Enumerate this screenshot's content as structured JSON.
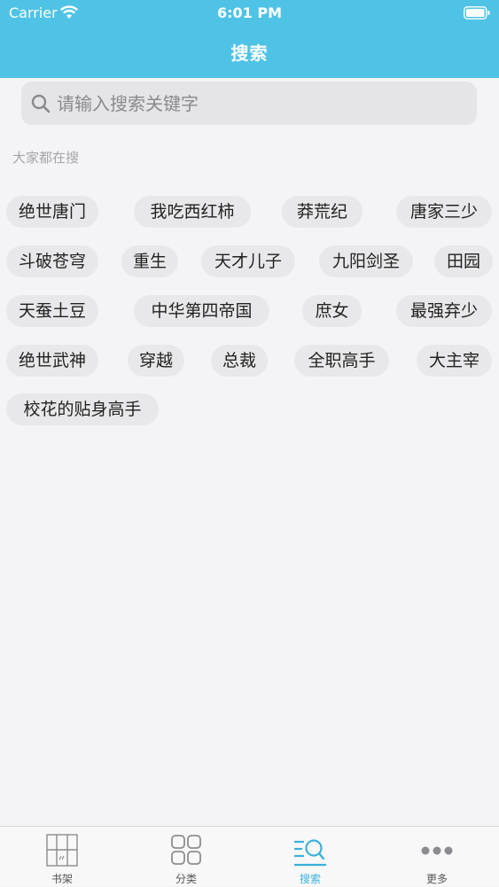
{
  "status_bar": {
    "carrier": "Carrier",
    "time": "6:01 PM"
  },
  "nav": {
    "title": "搜索"
  },
  "search": {
    "placeholder": "请输入搜索关键字",
    "value": ""
  },
  "hot": {
    "label": "大家都在搜",
    "tags": [
      "绝世唐门",
      "我吃西红柿",
      "莽荒纪",
      "唐家三少",
      "斗破苍穹",
      "重生",
      "天才儿子",
      "九阳剑圣",
      "田园",
      "天蚕土豆",
      "中华第四帝国",
      "庶女",
      "最强弃少",
      "绝世武神",
      "穿越",
      "总裁",
      "全职高手",
      "大主宰",
      "校花的贴身高手"
    ]
  },
  "tabbar": {
    "items": [
      {
        "label": "书架",
        "icon": "bookshelf-icon"
      },
      {
        "label": "分类",
        "icon": "grid-icon"
      },
      {
        "label": "搜索",
        "icon": "search-list-icon",
        "active": true
      },
      {
        "label": "更多",
        "icon": "more-icon"
      }
    ]
  },
  "colors": {
    "accent": "#4fc3e6",
    "active_tab": "#3ab1db",
    "background": "#f4f3f5"
  }
}
